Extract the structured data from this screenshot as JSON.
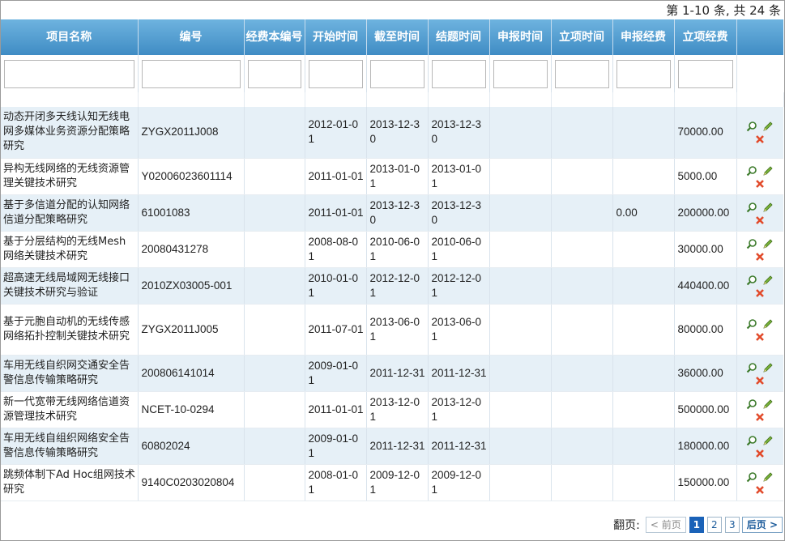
{
  "summary": "第 1-10 条, 共 24 条",
  "columns": [
    "项目名称",
    "编号",
    "经费本编号",
    "开始时间",
    "截至时间",
    "结题时间",
    "申报时间",
    "立项时间",
    "申报经费",
    "立项经费",
    ""
  ],
  "rows": [
    {
      "name": "动态开闭多天线认知无线电网多媒体业务资源分配策略研究",
      "code": "ZYGX2011J008",
      "start": "2012-01-01",
      "end": "2013-12-30",
      "finish": "2013-12-30",
      "apply_fund": "",
      "fund": "70000.00"
    },
    {
      "name": "异构无线网络的无线资源管理关键技术研究",
      "code": "Y02006023601114",
      "start": "2011-01-01",
      "end": "2013-01-01",
      "finish": "2013-01-01",
      "apply_fund": "",
      "fund": "5000.00"
    },
    {
      "name": "基于多信道分配的认知网络信道分配策略研究",
      "code": "61001083",
      "start": "2011-01-01",
      "end": "2013-12-30",
      "finish": "2013-12-30",
      "apply_fund": "0.00",
      "fund": "200000.00"
    },
    {
      "name": "基于分层结构的无线Mesh网络关键技术研究",
      "code": "20080431278",
      "start": "2008-08-01",
      "end": "2010-06-01",
      "finish": "2010-06-01",
      "apply_fund": "",
      "fund": "30000.00"
    },
    {
      "name": "超高速无线局域网无线接口关键技术研究与验证",
      "code": "2010ZX03005-001",
      "start": "2010-01-01",
      "end": "2012-12-01",
      "finish": "2012-12-01",
      "apply_fund": "",
      "fund": "440400.00"
    },
    {
      "name": "基于元胞自动机的无线传感网络拓扑控制关键技术研究",
      "code": "ZYGX2011J005",
      "start": "2011-07-01",
      "end": "2013-06-01",
      "finish": "2013-06-01",
      "apply_fund": "",
      "fund": "80000.00"
    },
    {
      "name": "车用无线自织网交通安全告警信息传输策略研究",
      "code": "200806141014",
      "start": "2009-01-01",
      "end": "2011-12-31",
      "finish": "2011-12-31",
      "apply_fund": "",
      "fund": "36000.00"
    },
    {
      "name": "新一代宽带无线网络信道资源管理技术研究",
      "code": "NCET-10-0294",
      "start": "2011-01-01",
      "end": "2013-12-01",
      "finish": "2013-12-01",
      "apply_fund": "",
      "fund": "500000.00"
    },
    {
      "name": "车用无线自组织网络安全告警信息传输策略研究",
      "code": "60802024",
      "start": "2009-01-01",
      "end": "2011-12-31",
      "finish": "2011-12-31",
      "apply_fund": "",
      "fund": "180000.00"
    },
    {
      "name": "跳频体制下Ad Hoc组网技术研究",
      "code": "9140C0203020804",
      "start": "2008-01-01",
      "end": "2009-12-01",
      "finish": "2009-12-01",
      "apply_fund": "",
      "fund": "150000.00"
    }
  ],
  "pager": {
    "label": "翻页:",
    "prev": "< 前页",
    "pages": [
      "1",
      "2",
      "3"
    ],
    "next": "后页 >"
  },
  "icons": {
    "view": "magnifier-icon",
    "edit": "pencil-icon",
    "delete": "delete-x-icon"
  }
}
